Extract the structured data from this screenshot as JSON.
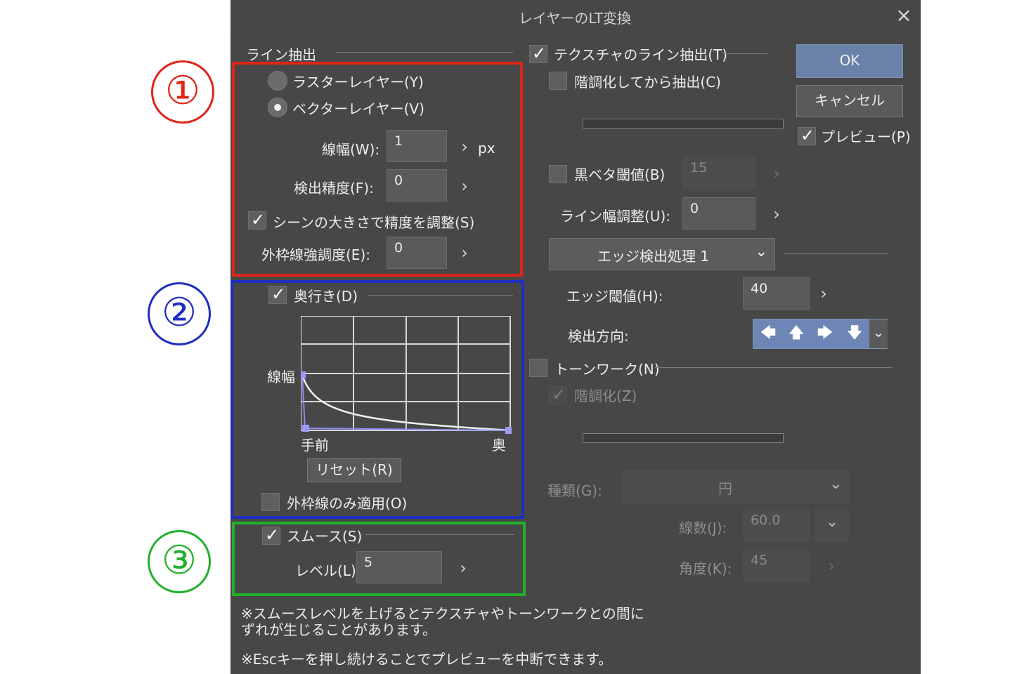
{
  "window": {
    "title": "レイヤーのLT変換",
    "close": "×"
  },
  "callouts": [
    {
      "label": "①",
      "color": "#e02418"
    },
    {
      "label": "②",
      "color": "#1f2ec2"
    },
    {
      "label": "③",
      "color": "#22b02a"
    }
  ],
  "line": {
    "heading": "ライン抽出",
    "raster": "ラスターレイヤー(Y)",
    "vector": "ベクターレイヤー(V)",
    "selected": "vector",
    "width_label": "線幅(W):",
    "width_value": "1",
    "width_unit": "px",
    "precision_label": "検出精度(F):",
    "precision_value": "0",
    "scene_label": "シーンの大きさで精度を調整(S)",
    "scene_checked": true,
    "outline_label": "外枠線強調度(E):",
    "outline_value": "0"
  },
  "depth": {
    "label": "奥行き(D)",
    "checked": true,
    "y_label": "線幅",
    "x_near": "手前",
    "x_far": "奥",
    "reset": "リセット(R)",
    "outline_only": "外枠線のみ適用(O)",
    "outline_only_checked": false
  },
  "smooth": {
    "label": "スムース(S)",
    "checked": true,
    "level_label": "レベル(L):",
    "level_value": "5"
  },
  "notes": {
    "line1": "※スムースレベルを上げるとテクスチャやトーンワークとの間に",
    "line2": "ずれが生じることがあります。",
    "line3": "※Escキーを押し続けることでプレビューを中断できます。"
  },
  "texture": {
    "label": "テクスチャのライン抽出(T)",
    "checked": true,
    "posterize_label": "階調化してから抽出(C)",
    "posterize_checked": false,
    "black_label": "黒ベタ閾値(B)",
    "black_checked": false,
    "black_value": "15",
    "linewidth_label": "ライン幅調整(U):",
    "linewidth_value": "0",
    "edge_mode": "エッジ検出処理 1",
    "edge_th_label": "エッジ閾値(H):",
    "edge_th_value": "40",
    "direction_label": "検出方向:",
    "direction_icons": [
      "arrow-left-icon",
      "arrow-up-icon",
      "arrow-right-icon",
      "arrow-down-icon"
    ],
    "direction_glyphs": [
      "🡄",
      "🡅",
      "🡆",
      "🡇"
    ]
  },
  "tone": {
    "label": "トーンワーク(N)",
    "checked": false,
    "posterize_label": "階調化(Z)",
    "posterize_checked": true,
    "type_label": "種類(G):",
    "type_value": "円",
    "lines_label": "線数(J):",
    "lines_value": "60.0",
    "angle_label": "角度(K):",
    "angle_value": "45"
  },
  "buttons": {
    "ok": "OK",
    "cancel": "キャンセル",
    "preview": "プレビュー(P)",
    "preview_checked": true
  },
  "colors": {
    "dialog_bg": "#474747",
    "accent": "#6b82a8",
    "red": "#e02418",
    "blue": "#1f2ec2",
    "green": "#22b02a"
  }
}
